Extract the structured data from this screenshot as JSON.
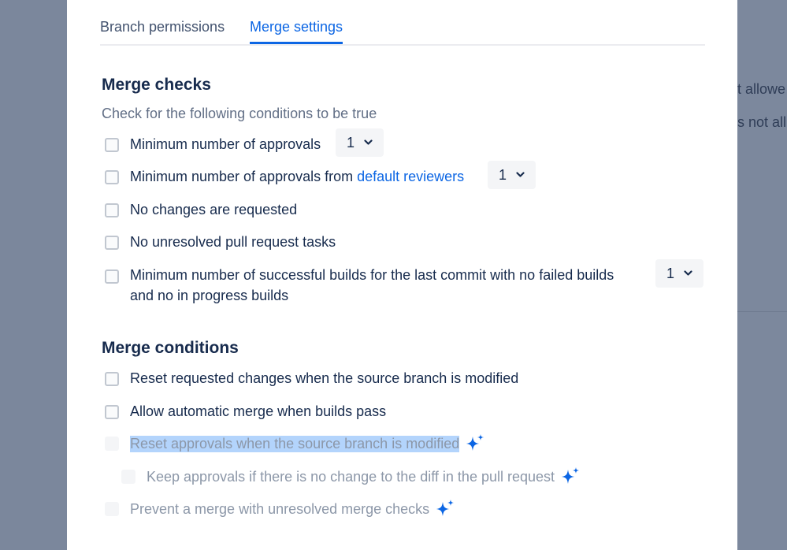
{
  "background": {
    "text_1": "t allowe",
    "text_2": "s not all"
  },
  "tabs": [
    {
      "label": "Branch permissions"
    },
    {
      "label": "Merge settings"
    }
  ],
  "merge_checks": {
    "title": "Merge checks",
    "subtitle": "Check for the following conditions to be true",
    "items": [
      {
        "label": "Minimum number of approvals",
        "select_value": "1"
      },
      {
        "label": "Minimum number of approvals from",
        "link": "default reviewers",
        "select_value": "1"
      },
      {
        "label": "No changes are requested"
      },
      {
        "label": "No unresolved pull request tasks"
      },
      {
        "label_line1": "Minimum number of successful builds for the last commit with no failed builds",
        "label_line2": "and no in progress builds",
        "select_value": "1"
      }
    ]
  },
  "merge_conditions": {
    "title": "Merge conditions",
    "items": [
      {
        "label": "Reset requested changes when the source branch is modified"
      },
      {
        "label": "Allow automatic merge when builds pass"
      },
      {
        "label": "Reset approvals when the source branch is modified"
      },
      {
        "label": "Keep approvals if there is no change to the diff in the pull request"
      },
      {
        "label": "Prevent a merge with unresolved merge checks"
      }
    ]
  },
  "colors": {
    "accent": "#0c66e4",
    "text": "#172b4d",
    "disabled_text": "#8c97a8",
    "highlight": "#b3d4fc"
  },
  "icons": {
    "sparkle": "sparkle-icon",
    "chevron": "chevron-down-icon"
  }
}
